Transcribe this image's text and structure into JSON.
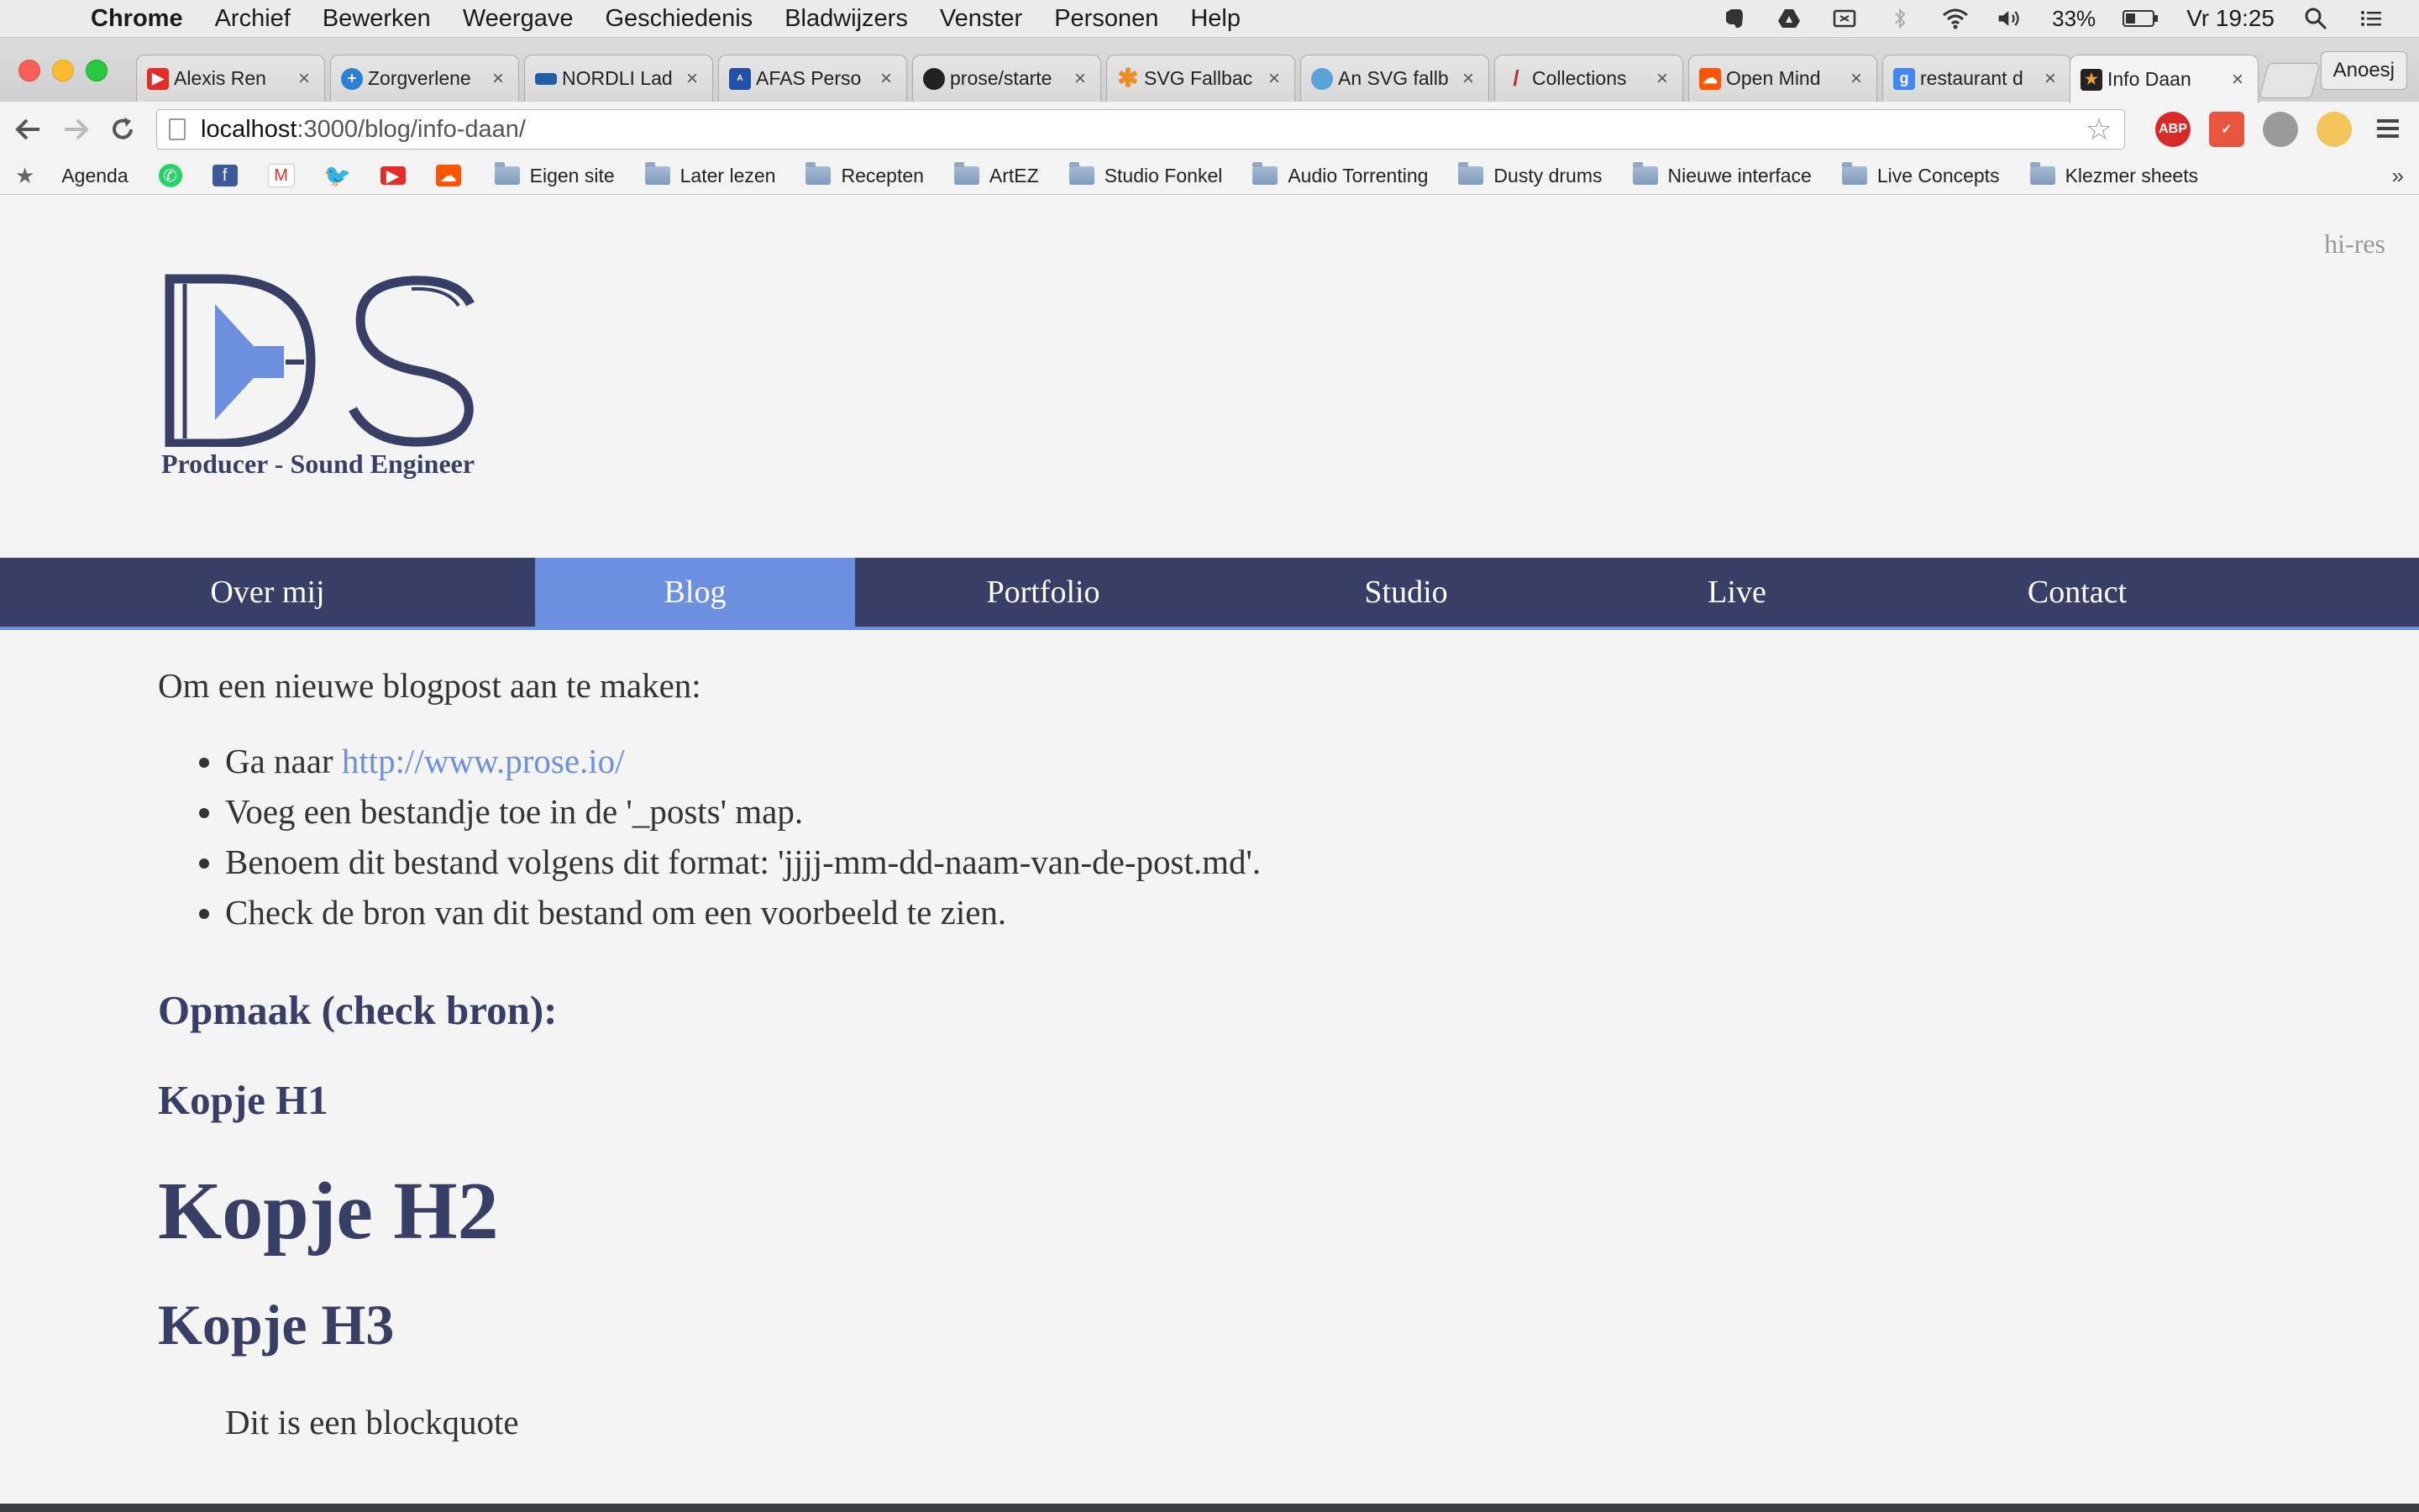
{
  "menubar": {
    "app": "Chrome",
    "items": [
      "Archief",
      "Bewerken",
      "Weergave",
      "Geschiedenis",
      "Bladwijzers",
      "Venster",
      "Personen",
      "Help"
    ],
    "battery": "33%",
    "clock": "Vr 19:25"
  },
  "tabs": [
    {
      "title": "Alexis Ren",
      "favicon": "youtube-icon",
      "color": "#e52d27"
    },
    {
      "title": "Zorgverlene",
      "favicon": "plus-cross-icon",
      "color": "#2c7fd3"
    },
    {
      "title": "NORDLI Lad",
      "favicon": "ikea-icon",
      "color": "#1f5fa6"
    },
    {
      "title": "AFAS Perso",
      "favicon": "afas-icon",
      "color": "#2350a8"
    },
    {
      "title": "prose/starte",
      "favicon": "github-icon",
      "color": "#222222"
    },
    {
      "title": "SVG Fallbac",
      "favicon": "star-burst-icon",
      "color": "#f08a24"
    },
    {
      "title": "An SVG fallb",
      "favicon": "globe-icon",
      "color": "#5aa3d8"
    },
    {
      "title": "Collections",
      "favicon": "feather-icon",
      "color": "#c62828"
    },
    {
      "title": "Open Mind",
      "favicon": "soundcloud-icon",
      "color": "#ff5500"
    },
    {
      "title": "restaurant d",
      "favicon": "google-icon",
      "color": "#4285f4"
    },
    {
      "title": "Info Daan",
      "favicon": "jekyll-star-icon",
      "color": "#222222",
      "active": true
    }
  ],
  "profile": "Anoesj",
  "toolbar": {
    "url_host": "localhost",
    "url_path": ":3000/blog/info-daan/",
    "abp_label": "ABP"
  },
  "bookmarks": [
    {
      "label": "Agenda",
      "type": "apple"
    },
    {
      "label": "",
      "type": "whatsapp"
    },
    {
      "label": "",
      "type": "facebook"
    },
    {
      "label": "",
      "type": "gmail"
    },
    {
      "label": "",
      "type": "twitter"
    },
    {
      "label": "",
      "type": "youtube"
    },
    {
      "label": "",
      "type": "soundcloud"
    },
    {
      "label": "Eigen site",
      "type": "folder"
    },
    {
      "label": "Later lezen",
      "type": "folder"
    },
    {
      "label": "Recepten",
      "type": "folder"
    },
    {
      "label": "ArtEZ",
      "type": "folder"
    },
    {
      "label": "Studio Fonkel",
      "type": "folder"
    },
    {
      "label": "Audio Torrenting",
      "type": "folder"
    },
    {
      "label": "Dusty drums",
      "type": "folder"
    },
    {
      "label": "Nieuwe interface",
      "type": "folder"
    },
    {
      "label": "Live Concepts",
      "type": "folder"
    },
    {
      "label": "Klezmer sheets",
      "type": "folder"
    }
  ],
  "page": {
    "hires": "hi-res",
    "logo_subtitle": "Producer - Sound Engineer",
    "nav": [
      {
        "label": "Over mij"
      },
      {
        "label": "Blog",
        "active": true
      },
      {
        "label": "Portfolio"
      },
      {
        "label": "Studio"
      },
      {
        "label": "Live"
      },
      {
        "label": "Contact"
      }
    ],
    "intro": "Om een nieuwe blogpost aan te maken:",
    "bullets": {
      "b1_prefix": "Ga naar ",
      "b1_link": "http://www.prose.io/",
      "b2": "Voeg een bestandje toe in de '_posts' map.",
      "b3": "Benoem dit bestand volgens dit format: 'jjjj-mm-dd-naam-van-de-post.md'.",
      "b4": "Check de bron van dit bestand om een voorbeeld te zien."
    },
    "heading_opmaak": "Opmaak (check bron):",
    "heading_h1": "Kopje H1",
    "heading_h2": "Kopje H2",
    "heading_h3": "Kopje H3",
    "blockquote": "Dit is een blockquote"
  },
  "colors": {
    "nav_bg": "#383f66",
    "nav_active": "#6d8fe0",
    "link": "#6d8fe0",
    "heading": "#383f66"
  }
}
